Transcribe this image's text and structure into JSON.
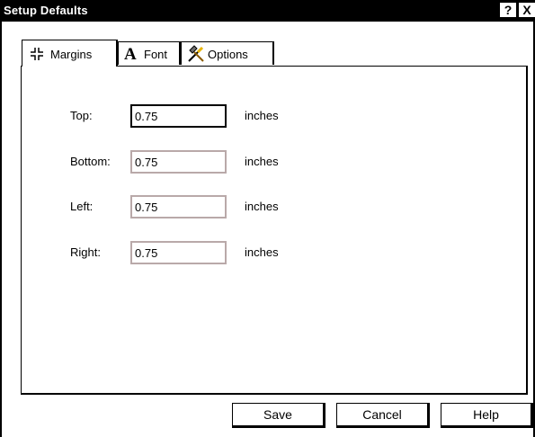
{
  "window": {
    "title": "Setup Defaults",
    "help_button": "?",
    "close_button": "X"
  },
  "tabs": [
    {
      "label": "Margins",
      "icon": "margins-icon",
      "selected": true
    },
    {
      "label": "Font",
      "icon": "font-icon",
      "selected": false
    },
    {
      "label": "Options",
      "icon": "tools-icon",
      "selected": false
    }
  ],
  "font_icon_glyph": "A",
  "margins": {
    "rows": [
      {
        "label": "Top:",
        "value": "0.75",
        "unit": "inches"
      },
      {
        "label": "Bottom:",
        "value": "0.75",
        "unit": "inches"
      },
      {
        "label": "Left:",
        "value": "0.75",
        "unit": "inches"
      },
      {
        "label": "Right:",
        "value": "0.75",
        "unit": "inches"
      }
    ]
  },
  "buttons": {
    "save": "Save",
    "cancel": "Cancel",
    "help": "Help"
  },
  "colors": {
    "title_bar": "#000000",
    "field_border": "#b9a9a9",
    "tools_icon_handle": "#e8b400"
  }
}
